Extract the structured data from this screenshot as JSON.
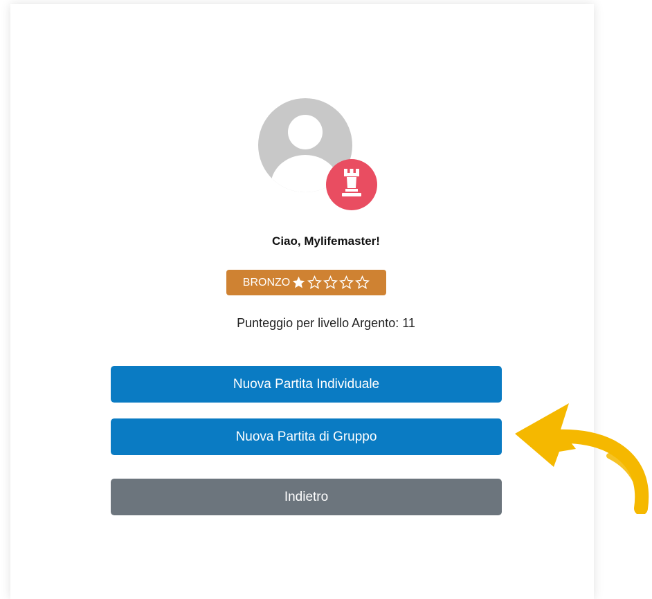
{
  "profile": {
    "greeting": "Ciao, Mylifemaster!",
    "avatar_icon": "user-avatar-icon",
    "avatar_badge_icon": "chess-rook-icon"
  },
  "level": {
    "name": "BRONZO",
    "stars_filled": 1,
    "stars_total": 5,
    "badge_color": "#cf8232"
  },
  "score": {
    "label": "Punteggio per livello Argento: 11"
  },
  "actions": {
    "new_individual": "Nuova Partita Individuale",
    "new_group": "Nuova Partita di Gruppo",
    "back": "Indietro"
  },
  "colors": {
    "primary": "#0a7bc3",
    "secondary": "#6c757d",
    "avatar_badge": "#e94d61",
    "arrow": "#f5b800"
  },
  "annotation": {
    "arrow_icon": "pointer-arrow-icon"
  }
}
